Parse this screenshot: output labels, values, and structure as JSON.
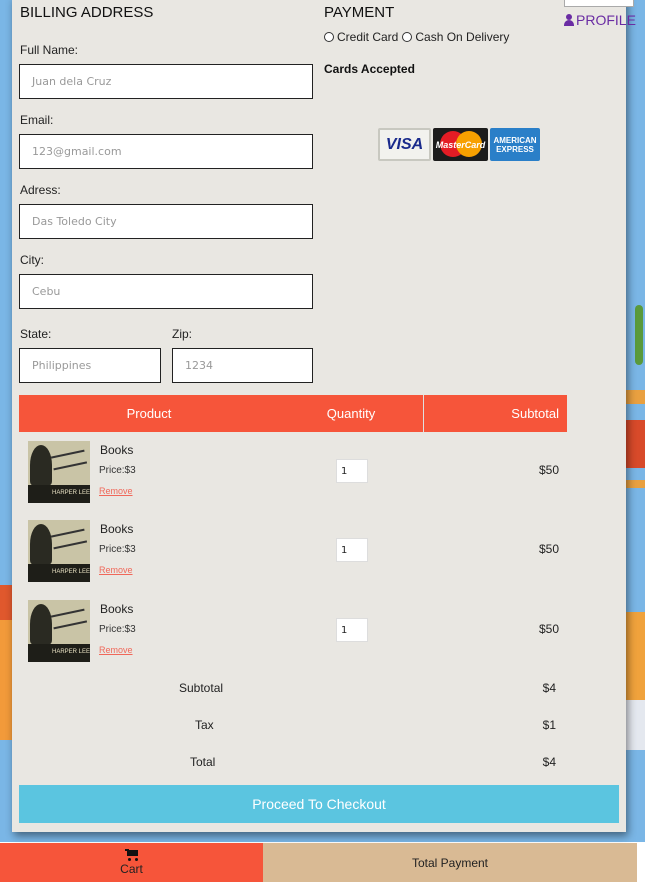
{
  "header": {
    "profile_label": "PROFILE"
  },
  "billing": {
    "title": "BILLING ADDRESS",
    "full_name": {
      "label": "Full Name:",
      "placeholder": "Juan dela Cruz"
    },
    "email": {
      "label": "Email:",
      "placeholder": "123@gmail.com"
    },
    "address": {
      "label": "Adress:",
      "placeholder": "Das Toledo City"
    },
    "city": {
      "label": "City:",
      "placeholder": "Cebu"
    },
    "state": {
      "label": "State:",
      "placeholder": "Philippines"
    },
    "zip": {
      "label": "Zip:",
      "placeholder": "1234"
    }
  },
  "payment": {
    "title": "PAYMENT",
    "options": [
      "Credit Card",
      "Cash On Delivery"
    ],
    "cards_accepted": "Cards Accepted",
    "card_logos": {
      "visa": "VISA",
      "mastercard": "MasterCard",
      "amex_line1": "AMERICAN",
      "amex_line2": "EXPRESS"
    }
  },
  "cart_table": {
    "headers": {
      "product": "Product",
      "quantity": "Quantity",
      "subtotal": "Subtotal"
    },
    "items": [
      {
        "name": "Books",
        "price": "Price:$3",
        "remove": "Remove",
        "qty": "1",
        "subtotal": "$50",
        "cover_author": "HARPER LEE"
      },
      {
        "name": "Books",
        "price": "Price:$3",
        "remove": "Remove",
        "qty": "1",
        "subtotal": "$50",
        "cover_author": "HARPER LEE"
      },
      {
        "name": "Books",
        "price": "Price:$3",
        "remove": "Remove",
        "qty": "1",
        "subtotal": "$50",
        "cover_author": "HARPER LEE"
      }
    ]
  },
  "totals": {
    "subtotal_label": "Subtotal",
    "subtotal_value": "$4",
    "tax_label": "Tax",
    "tax_value": "$1",
    "total_label": "Total",
    "total_value": "$4"
  },
  "checkout_label": "Proceed To Checkout",
  "bottom_bar": {
    "cart_label": "Cart",
    "total_payment_label": "Total Payment"
  },
  "colors": {
    "accent_red": "#f6553a",
    "checkout_blue": "#5bc5e0",
    "profile_purple": "#6a2ca3",
    "total_tan": "#d9ba94",
    "card_bg": "#e9e7e2"
  }
}
